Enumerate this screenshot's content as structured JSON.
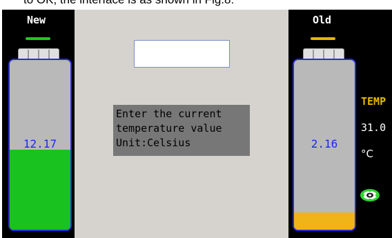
{
  "caption": "to OK, the interface is as shown in Fig.8:",
  "left_battery": {
    "label": "New",
    "value": "12.17",
    "fill_fraction": 0.47,
    "fill_color": "#19c21e",
    "value_color": "#1a2ae0",
    "indicator_color": "#22c822"
  },
  "right_battery": {
    "label": "Old",
    "value": "2.16",
    "fill_fraction": 0.1,
    "fill_color": "#f0b418",
    "value_color": "#1a2ae0",
    "indicator_color": "#e6b800"
  },
  "dialog": {
    "input_value": "",
    "message": "Enter the current\ntemperature value\nUnit:Celsius"
  },
  "side_panel": {
    "temp_label": "TEMP",
    "temp_value": "31.0",
    "temp_unit": "°C",
    "temp_label_color": "#e6b800",
    "settings_icon": "gear-icon"
  }
}
